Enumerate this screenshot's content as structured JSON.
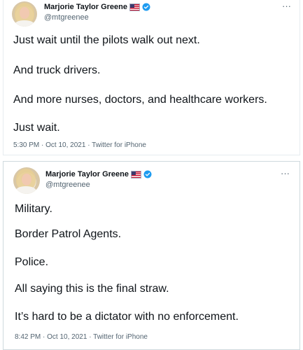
{
  "tweets": [
    {
      "author": {
        "name": "Marjorie Taylor Greene",
        "handle": "@mtgreenee",
        "flag_icon": "us-flag-icon",
        "verified_icon": "verified-badge-icon"
      },
      "more_icon": "···",
      "lines": [
        "Just wait until the pilots walk out next.",
        "And truck drivers.",
        "And more nurses, doctors, and healthcare workers.",
        "Just wait."
      ],
      "time": "5:30 PM",
      "date": "Oct 10, 2021",
      "source": "Twitter for iPhone"
    },
    {
      "author": {
        "name": "Marjorie Taylor Greene",
        "handle": "@mtgreenee",
        "flag_icon": "us-flag-icon",
        "verified_icon": "verified-badge-icon"
      },
      "more_icon": "···",
      "lines": [
        "Military.",
        "Border Patrol Agents.",
        "Police.",
        "All saying this is the final straw.",
        "It’s hard to be a dictator with no enforcement."
      ],
      "time": "8:42 PM",
      "date": "Oct 10, 2021",
      "source": "Twitter for iPhone"
    }
  ],
  "meta_separator": "·",
  "colors": {
    "text": "#0f1419",
    "secondary": "#536471",
    "verified_blue": "#1d9bf0",
    "border": "#cfd9de"
  }
}
